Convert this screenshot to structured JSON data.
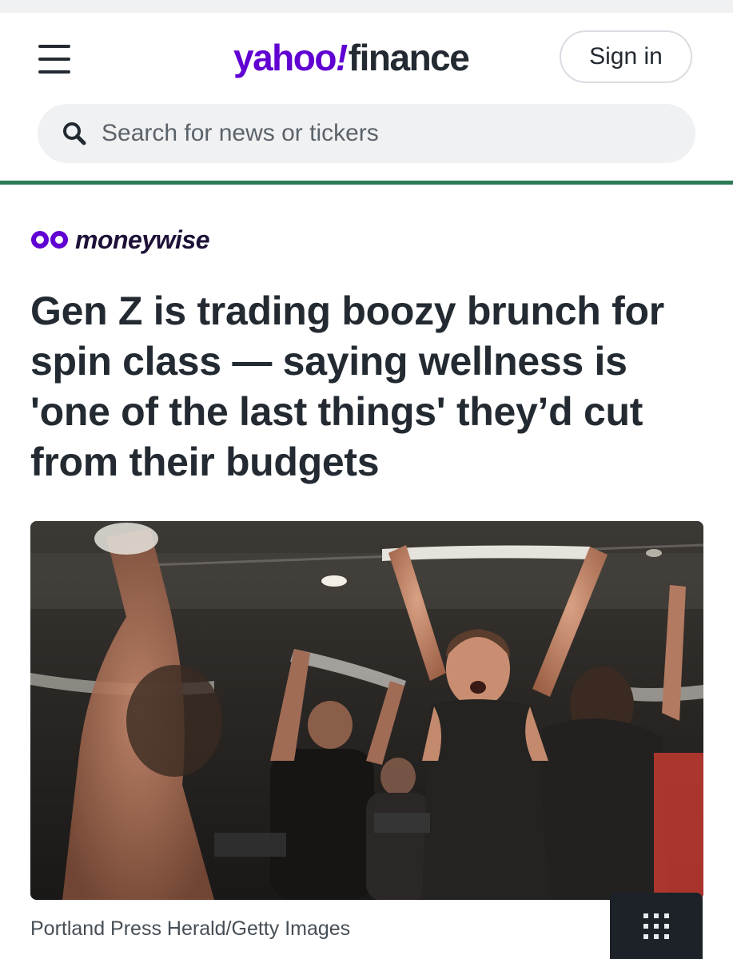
{
  "header": {
    "logo_brand": "yahoo",
    "logo_bang": "!",
    "logo_product": "finance",
    "signin_label": "Sign in",
    "menu_icon": "hamburger-menu-icon"
  },
  "search": {
    "placeholder": "Search for news or tickers",
    "icon": "search-icon"
  },
  "article": {
    "source": "moneywise",
    "headline": "Gen Z is trading boozy brunch for spin class — saying wellness is 'one of the last things' they’d cut from their budgets",
    "image_caption": "Portland Press Herald/Getty Images",
    "gallery_icon": "grid-icon"
  },
  "colors": {
    "brand_purple": "#6001d2",
    "rule_green": "#2b7a56",
    "text_dark": "#232a31"
  }
}
